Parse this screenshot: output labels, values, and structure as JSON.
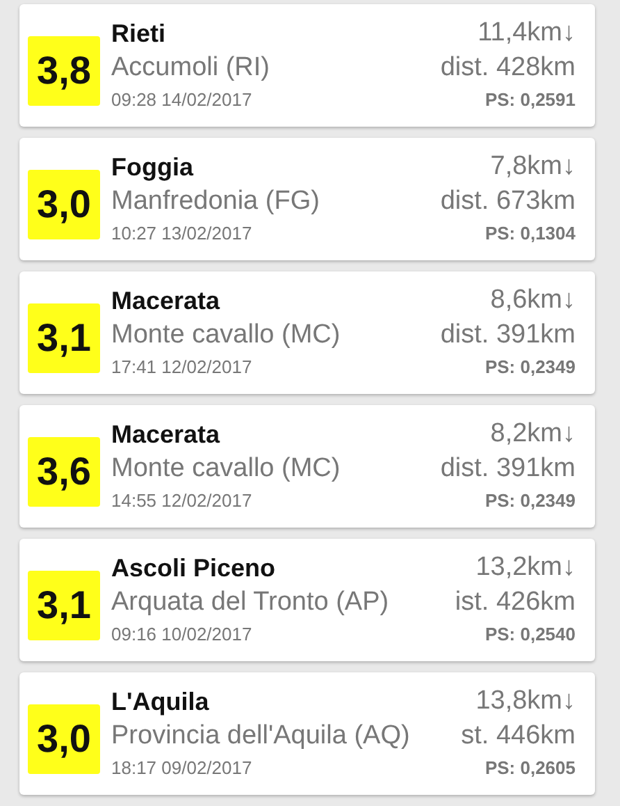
{
  "events": [
    {
      "magnitude": "3,8",
      "region": "Rieti",
      "place": "Accumoli (RI)",
      "time": "09:28 14/02/2017",
      "depth": "11,4km↓",
      "distance": "dist. 428km",
      "ps": "PS: 0,2591"
    },
    {
      "magnitude": "3,0",
      "region": "Foggia",
      "place": "Manfredonia (FG)",
      "time": "10:27 13/02/2017",
      "depth": "7,8km↓",
      "distance": "dist. 673km",
      "ps": "PS: 0,1304"
    },
    {
      "magnitude": "3,1",
      "region": "Macerata",
      "place": "Monte cavallo (MC)",
      "time": "17:41 12/02/2017",
      "depth": "8,6km↓",
      "distance": "dist. 391km",
      "ps": "PS: 0,2349"
    },
    {
      "magnitude": "3,6",
      "region": "Macerata",
      "place": "Monte cavallo (MC)",
      "time": "14:55 12/02/2017",
      "depth": "8,2km↓",
      "distance": "dist. 391km",
      "ps": "PS: 0,2349"
    },
    {
      "magnitude": "3,1",
      "region": "Ascoli Piceno",
      "place": "Arquata del Tronto (AP)",
      "time": "09:16 10/02/2017",
      "depth": "13,2km↓",
      "distance": "ist. 426km",
      "ps": "PS: 0,2540"
    },
    {
      "magnitude": "3,0",
      "region": "L'Aquila",
      "place": "Provincia dell'Aquila (AQ)",
      "time": "18:17 09/02/2017",
      "depth": "13,8km↓",
      "distance": "st. 446km",
      "ps": "PS: 0,2605"
    }
  ]
}
